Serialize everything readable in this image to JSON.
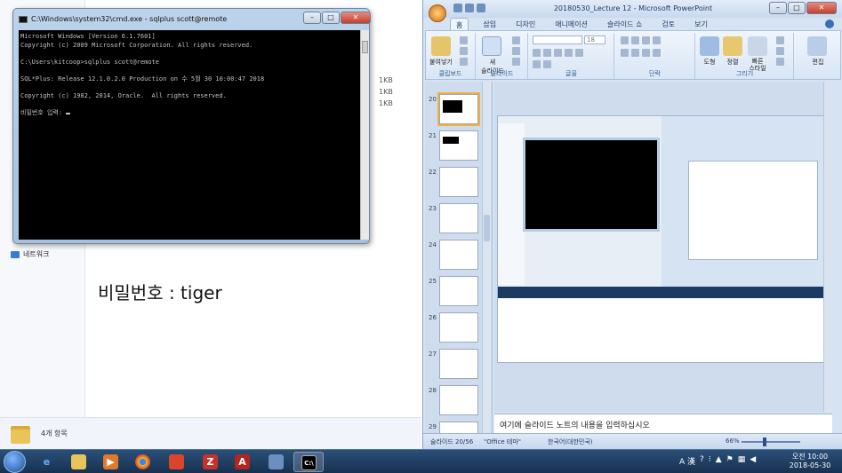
{
  "explorer": {
    "file_sizes": [
      "1KB",
      "1KB",
      "1KB"
    ],
    "nav_network": "네트워크",
    "item_count": "4개 항목"
  },
  "note": {
    "password_text": "비밀번호 : tiger"
  },
  "cmd": {
    "title": "C:\\Windows\\system32\\cmd.exe - sqlplus  scott@remote",
    "lines": [
      "Microsoft Windows [Version 6.1.7601]",
      "Copyright (c) 2009 Microsoft Corporation. All rights reserved.",
      "",
      "C:\\Users\\kitcoop>sqlplus scott@remote",
      "",
      "SQL*Plus: Release 12.1.0.2.0 Production on 수 5월 30 10:00:47 2018",
      "",
      "Copyright (c) 1982, 2014, Oracle.  All rights reserved.",
      "",
      "비밀번호 입력: "
    ]
  },
  "ppt": {
    "title": "20180530_Lecture 12 - Microsoft PowerPoint",
    "tabs": [
      "홈",
      "삽입",
      "디자인",
      "애니메이션",
      "슬라이드 쇼",
      "검토",
      "보기"
    ],
    "ribbon": {
      "clipboard_group": "클립보드",
      "paste_label": "붙여넣기",
      "slides_group": "슬라이드",
      "new_slide_label": "새\n슬라이드",
      "font_group": "글꼴",
      "font_size": "18",
      "paragraph_group": "단락",
      "drawing_group": "그리기",
      "shape_label": "도형",
      "arrange_label": "정렬",
      "quick_style_label": "빠른\n스타일",
      "edit_group": "편집",
      "edit_label": "편집"
    },
    "slide_numbers": [
      "20",
      "21",
      "22",
      "23",
      "24",
      "25",
      "26",
      "27",
      "28",
      "29"
    ],
    "notes_placeholder": "여기에 슬라이드 노트의 내용을 입력하십시오",
    "status": {
      "slide": "슬라이드 20/56",
      "theme": "\"Office 테마\"",
      "language": "한국어(대한민국)",
      "zoom": "66%"
    }
  },
  "taskbar": {
    "tray_ime": "A 漢",
    "clock_time": "오전 10:00",
    "clock_date": "2018-05-30"
  }
}
